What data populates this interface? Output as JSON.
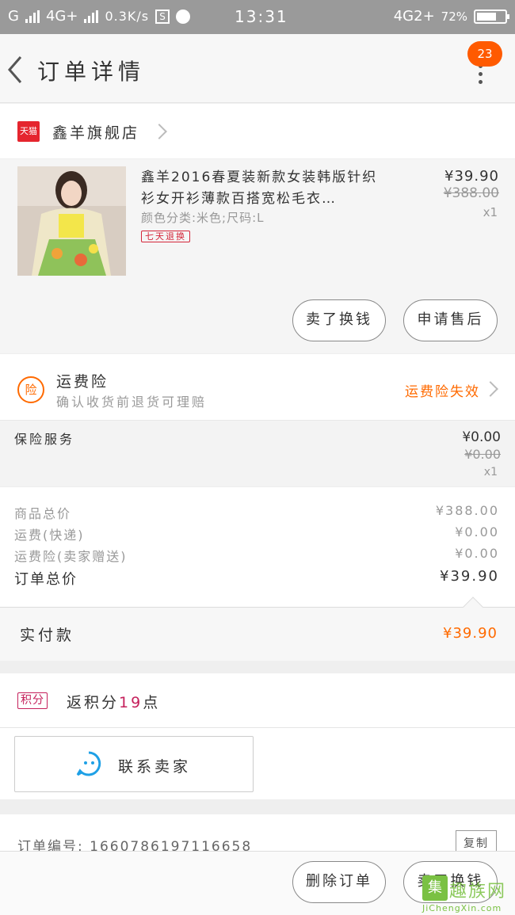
{
  "status_bar": {
    "carrier_left": "G",
    "network1": "4G+",
    "speed": "0.3K/s",
    "app_icon": "S",
    "time": "13:31",
    "network2": "4G2+",
    "battery": "72%",
    "battery_level": 0.72
  },
  "header": {
    "title": "订单详情",
    "badge_count": "23"
  },
  "shop": {
    "logo": "天猫",
    "name": "鑫羊旗舰店"
  },
  "product": {
    "title": "鑫羊2016春夏装新款女装韩版针织衫女开衫薄款百搭宽松毛衣…",
    "sku": "颜色分类:米色;尺码:L",
    "tag": "七天退换",
    "price": "¥39.90",
    "original_price": "¥388.00",
    "quantity": "x1"
  },
  "actions": {
    "exchange_label": "卖了换钱",
    "aftersale_label": "申请售后"
  },
  "insurance": {
    "icon": "险",
    "title": "运费险",
    "subtitle": "确认收货前退货可理赔",
    "status": "运费险失效"
  },
  "service": {
    "label": "保险服务",
    "price": "¥0.00",
    "original_price": "¥0.00",
    "quantity": "x1"
  },
  "summary": {
    "rows": [
      {
        "label": "商品总价",
        "value": "¥388.00"
      },
      {
        "label": "运费(快递)",
        "value": "¥0.00"
      },
      {
        "label": "运费险(卖家赠送)",
        "value": "¥0.00"
      }
    ],
    "total_label": "订单总价",
    "total_value": "¥39.90"
  },
  "payment": {
    "label": "实付款",
    "value": "¥39.90"
  },
  "points": {
    "tag": "积分",
    "prefix": "返积分",
    "count": "19",
    "suffix": "点"
  },
  "contact": {
    "label": "联系卖家"
  },
  "order": {
    "number_text": "订单编号: 1660786197116658",
    "copy_label": "复制"
  },
  "bottom": {
    "delete_label": "删除订单",
    "exchange_label": "卖了换钱"
  },
  "watermark": {
    "logo": "集",
    "text": "趣族网",
    "url": "JiChengXin.com"
  }
}
